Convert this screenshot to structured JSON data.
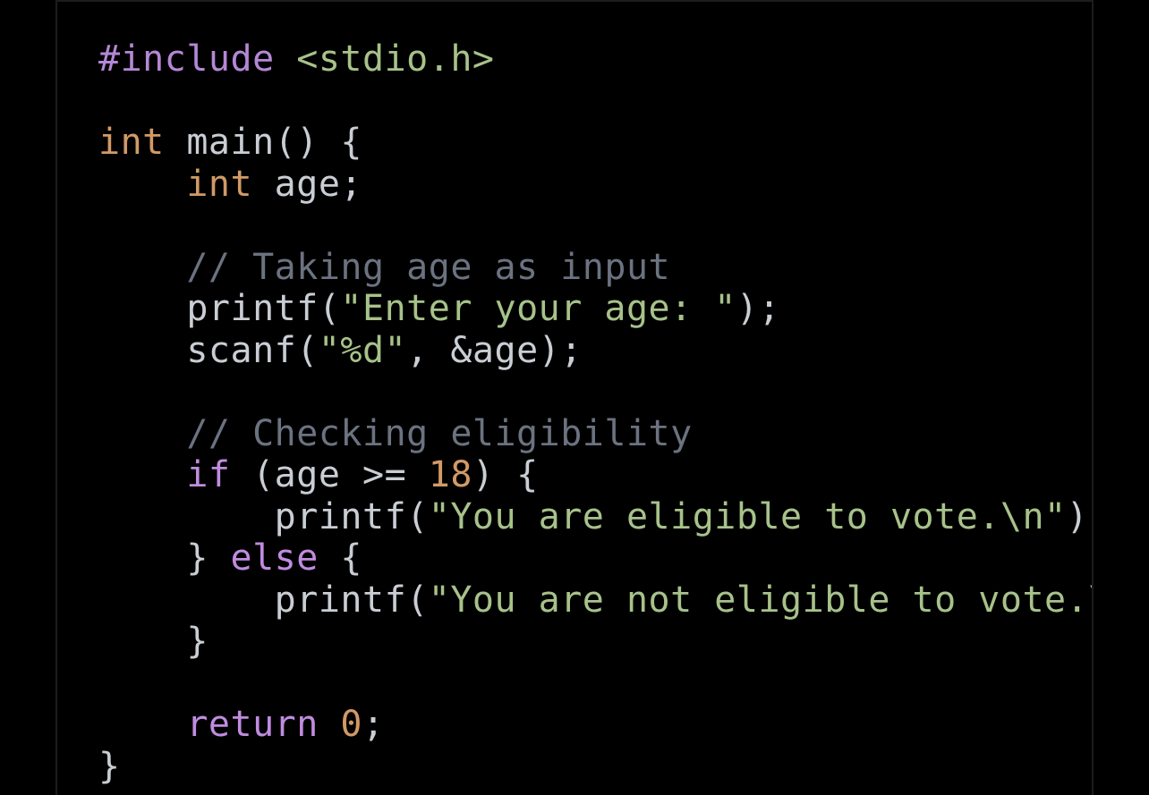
{
  "editor": {
    "lines": [
      [
        {
          "t": "pre",
          "v": "#include"
        },
        {
          "t": "plain",
          "v": " "
        },
        {
          "t": "str",
          "v": "<stdio.h>"
        }
      ],
      [],
      [
        {
          "t": "kw-type",
          "v": "int"
        },
        {
          "t": "plain",
          "v": " main() {"
        }
      ],
      [
        {
          "t": "plain",
          "v": "    "
        },
        {
          "t": "kw-type",
          "v": "int"
        },
        {
          "t": "plain",
          "v": " age;"
        }
      ],
      [],
      [
        {
          "t": "plain",
          "v": "    "
        },
        {
          "t": "cmt",
          "v": "// Taking age as input"
        }
      ],
      [
        {
          "t": "plain",
          "v": "    printf("
        },
        {
          "t": "str",
          "v": "\"Enter your age: \""
        },
        {
          "t": "plain",
          "v": ");"
        }
      ],
      [
        {
          "t": "plain",
          "v": "    scanf("
        },
        {
          "t": "str",
          "v": "\"%d\""
        },
        {
          "t": "plain",
          "v": ", &age);"
        }
      ],
      [],
      [
        {
          "t": "plain",
          "v": "    "
        },
        {
          "t": "cmt",
          "v": "// Checking eligibility"
        }
      ],
      [
        {
          "t": "plain",
          "v": "    "
        },
        {
          "t": "kw-ctrl",
          "v": "if"
        },
        {
          "t": "plain",
          "v": " (age >= "
        },
        {
          "t": "num",
          "v": "18"
        },
        {
          "t": "plain",
          "v": ") {"
        }
      ],
      [
        {
          "t": "plain",
          "v": "        printf("
        },
        {
          "t": "str",
          "v": "\"You are eligible to vote.\\n\""
        },
        {
          "t": "plain",
          "v": ");"
        }
      ],
      [
        {
          "t": "plain",
          "v": "    } "
        },
        {
          "t": "kw-ctrl",
          "v": "else"
        },
        {
          "t": "plain",
          "v": " {"
        }
      ],
      [
        {
          "t": "plain",
          "v": "        printf("
        },
        {
          "t": "str",
          "v": "\"You are not eligible to vote.\\n\""
        },
        {
          "t": "plain",
          "v": ");"
        }
      ],
      [
        {
          "t": "plain",
          "v": "    }"
        }
      ],
      [],
      [
        {
          "t": "plain",
          "v": "    "
        },
        {
          "t": "kw-ctrl",
          "v": "return"
        },
        {
          "t": "plain",
          "v": " "
        },
        {
          "t": "num",
          "v": "0"
        },
        {
          "t": "plain",
          "v": ";"
        }
      ],
      [
        {
          "t": "plain",
          "v": "}"
        }
      ]
    ]
  },
  "colors": {
    "background": "#000000",
    "plain": "#c9cdd4",
    "keyword_type": "#d19a66",
    "keyword_control": "#c08ce0",
    "preprocessor": "#b488d6",
    "string": "#a7c28a",
    "number": "#d19a66",
    "comment": "#6b7280"
  }
}
